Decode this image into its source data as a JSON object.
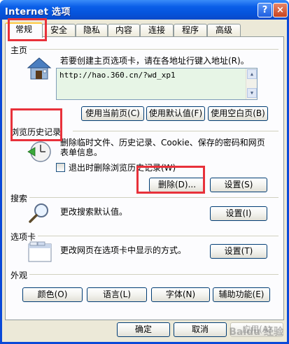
{
  "window": {
    "title": "Internet 选项",
    "help_label": "?",
    "close_label": "×"
  },
  "tabs": [
    {
      "label": "常规"
    },
    {
      "label": "安全"
    },
    {
      "label": "隐私"
    },
    {
      "label": "内容"
    },
    {
      "label": "连接"
    },
    {
      "label": "程序"
    },
    {
      "label": "高级"
    }
  ],
  "homepage": {
    "section_title": "主页",
    "description": "若要创建主页选项卡，请在各地址行键入地址(R)。",
    "url": "http://hao.360.cn/?wd_xp1",
    "use_current": "使用当前页(C)",
    "use_default": "使用默认值(F)",
    "use_blank": "使用空白页(B)"
  },
  "history": {
    "section_title": "浏览历史记录",
    "description_1": "删除临时文件、历史记录、Cookie、保存的密码和网页",
    "description_2": "表单信息。",
    "checkbox_label": "退出时删除浏览历史记录(W)",
    "delete_button": "删除(D)...",
    "settings_button": "设置(S)"
  },
  "search": {
    "section_title": "搜索",
    "description": "更改搜索默认值。",
    "settings_button": "设置(I)"
  },
  "tabs_section": {
    "section_title": "选项卡",
    "description": "更改网页在选项卡中显示的方式。",
    "settings_button": "设置(T)"
  },
  "appearance": {
    "section_title": "外观",
    "colors": "颜色(O)",
    "languages": "语言(L)",
    "fonts": "字体(N)",
    "accessibility": "辅助功能(E)"
  },
  "footer": {
    "ok": "确定",
    "cancel": "取消",
    "apply": "应用(A)"
  },
  "watermark": "Baidu 经验"
}
